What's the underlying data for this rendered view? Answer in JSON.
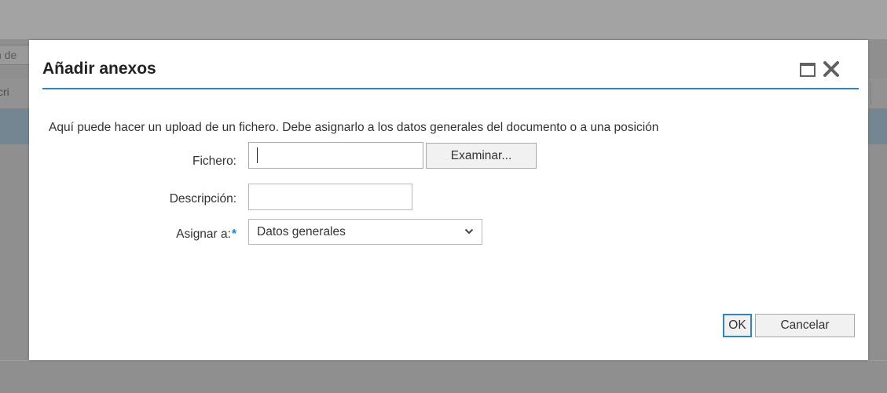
{
  "background": {
    "field_text": "n de",
    "header_text": "scri"
  },
  "dialog": {
    "title": "Añadir anexos",
    "intro": "Aquí puede hacer un upload de un fichero. Debe asignarlo a los datos generales del documento o a una posición",
    "file_label": "Fichero:",
    "file_value": "",
    "browse_label": "Examinar...",
    "description_label": "Descripción:",
    "description_value": "",
    "assign_label": "Asignar a:",
    "assign_required": "*",
    "assign_value": "Datos generales",
    "ok_label": "OK",
    "cancel_label": "Cancelar",
    "icons": {
      "maximize": "maximize-icon",
      "close": "close-icon",
      "dropdown": "chevron-down-icon"
    }
  },
  "colors": {
    "accent": "#2a87c6",
    "required": "#1a80d6",
    "overlay": "#8f8f8f"
  }
}
